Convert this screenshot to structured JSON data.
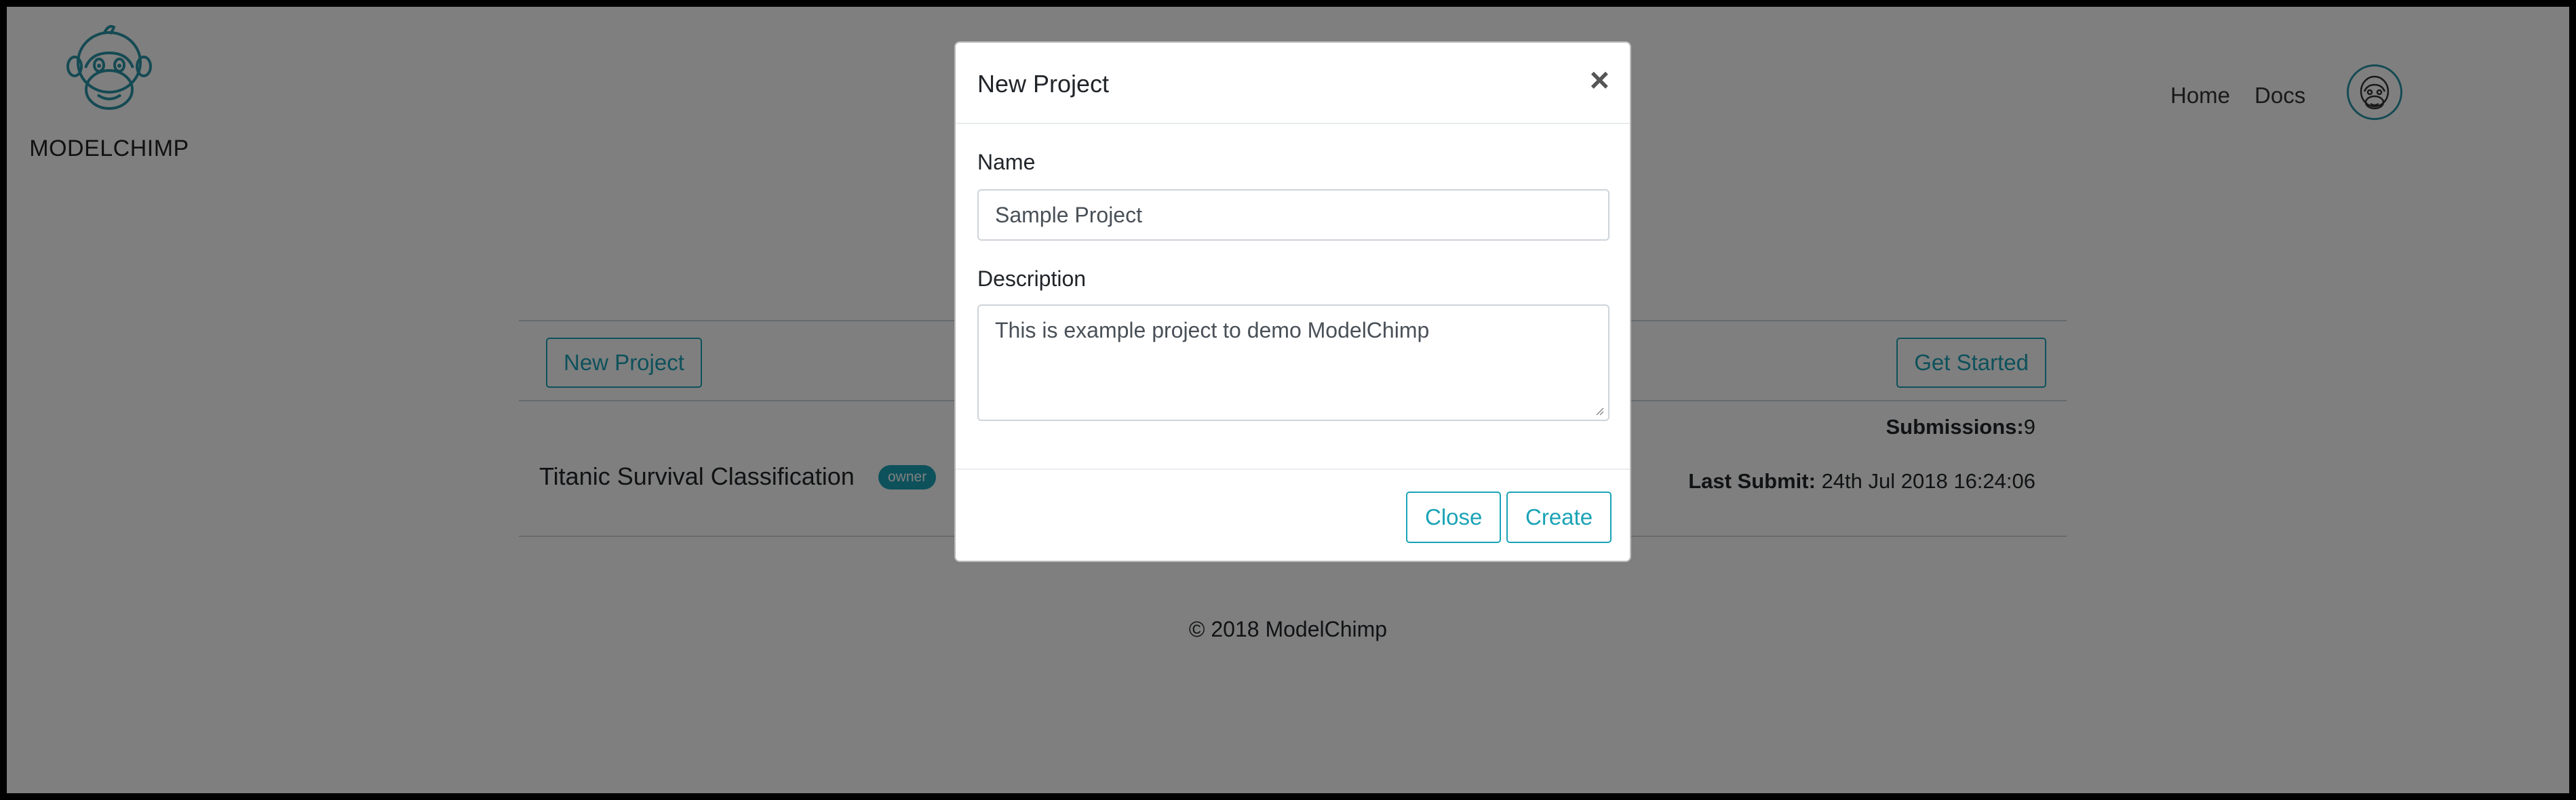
{
  "brand": {
    "name": "MODELCHIMP",
    "logo_icon": "chimp-logo-icon",
    "accent": "#1aa3b6"
  },
  "nav": {
    "home": "Home",
    "docs": "Docs",
    "avatar_icon": "chimp-avatar-icon"
  },
  "toolbar": {
    "new_project": "New Project",
    "get_started": "Get Started"
  },
  "projects": [
    {
      "name": "Titanic Survival Classification",
      "badge": "owner",
      "submissions_label": "Submissions:",
      "submissions_value": "9",
      "last_submit_label": "Last Submit:",
      "last_submit_value": "24th Jul 2018 16:24:06"
    }
  ],
  "footer": {
    "copyright": "© 2018 ModelChimp"
  },
  "modal": {
    "title": "New Project",
    "close_symbol": "×",
    "name_label": "Name",
    "name_value": "Sample Project",
    "description_label": "Description",
    "description_value": "This is example project to demo ModelChimp",
    "close_button": "Close",
    "create_button": "Create"
  }
}
